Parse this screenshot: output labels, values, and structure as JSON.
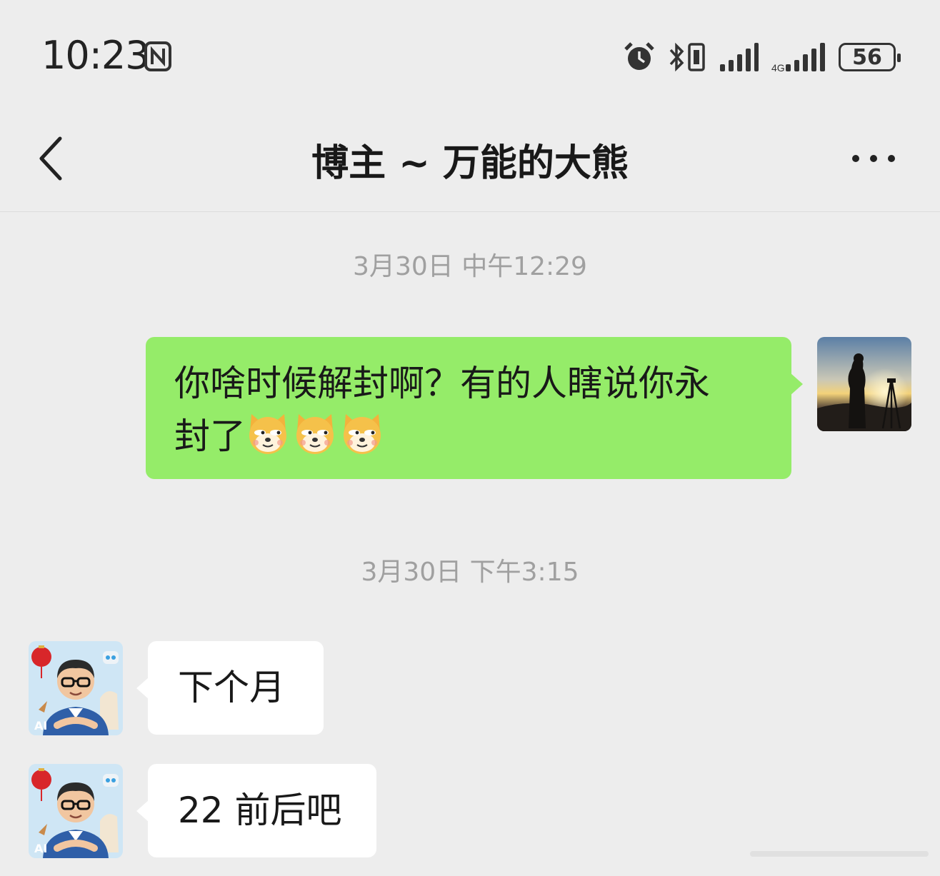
{
  "status_bar": {
    "time": "10:23",
    "battery": "56",
    "icons": [
      "nfc-icon",
      "alarm-icon",
      "bluetooth-icon",
      "vibrate-icon",
      "signal-icon",
      "signal-4g-icon",
      "battery-icon"
    ]
  },
  "nav": {
    "title": "博主 ~ 万能的大熊",
    "back_icon": "chevron-left-icon",
    "more_icon": "more-icon"
  },
  "messages": [
    {
      "type": "timestamp",
      "text": "3月30日 中午12:29"
    },
    {
      "type": "sent",
      "text_line1": "你啥时候解封啊？有的人瞎说你永",
      "text_line2": "封了",
      "emoji": [
        "doge-emoji",
        "doge-emoji",
        "doge-emoji"
      ]
    },
    {
      "type": "timestamp",
      "text": "3月30日 下午3:15"
    },
    {
      "type": "received",
      "text": "下个月",
      "avatar_badge": "AI"
    },
    {
      "type": "received",
      "text": "22 前后吧",
      "avatar_badge": "AI"
    }
  ],
  "colors": {
    "background": "#ededed",
    "sent_bubble": "#95ec69",
    "received_bubble": "#ffffff",
    "timestamp_text": "#a0a0a0"
  }
}
